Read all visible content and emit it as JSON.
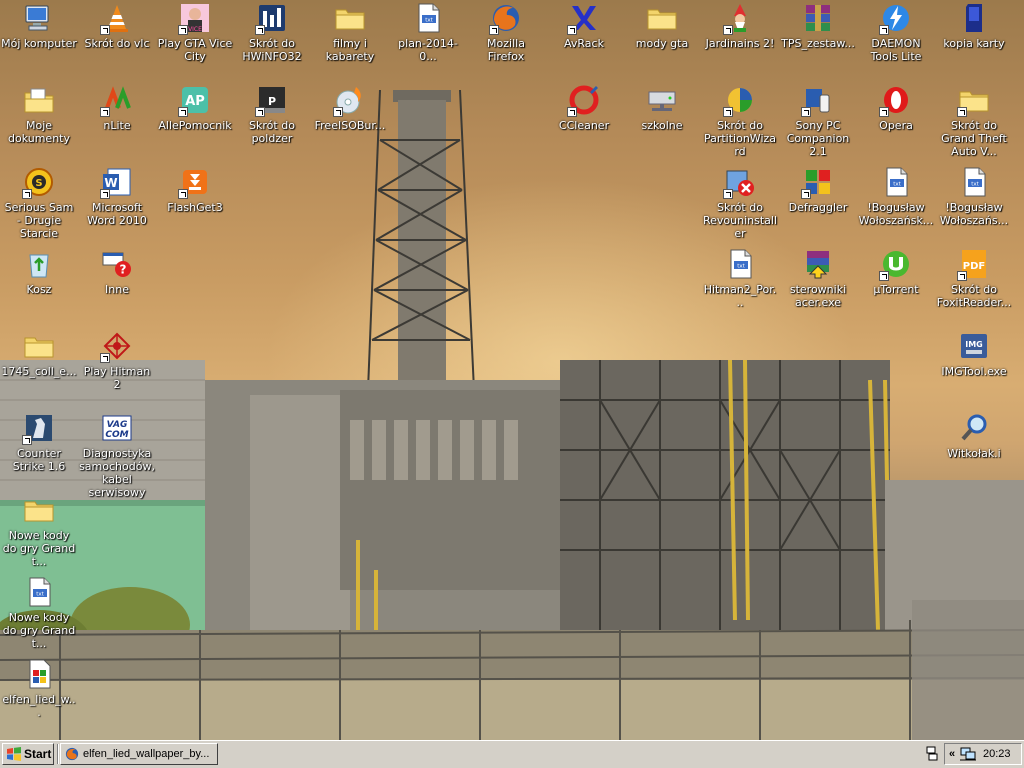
{
  "desktop": {
    "icons": [
      {
        "label": "Mój komputer",
        "icon": "computer-icon",
        "shortcut": false
      },
      {
        "label": "Skrót do vlc",
        "icon": "vlc-cone-icon",
        "shortcut": true
      },
      {
        "label": "Play GTA Vice City",
        "icon": "gta-vice-city-icon",
        "shortcut": true
      },
      {
        "label": "Skrót do HWiNFO32",
        "icon": "hwinfo-icon",
        "shortcut": true
      },
      {
        "label": "filmy i kabarety",
        "icon": "folder-icon",
        "shortcut": false
      },
      {
        "label": "plan-2014-0...",
        "icon": "document-icon",
        "shortcut": false
      },
      {
        "label": "Mozilla Firefox",
        "icon": "firefox-icon",
        "shortcut": true
      },
      {
        "label": "AvRack",
        "icon": "avrack-icon",
        "shortcut": true
      },
      {
        "label": "mody gta",
        "icon": "folder-icon",
        "shortcut": false
      },
      {
        "label": "Jardinains 2!",
        "icon": "jardinains-gnome-icon",
        "shortcut": true
      },
      {
        "label": "TPS_zestaw...",
        "icon": "winrar-icon",
        "shortcut": false
      },
      {
        "label": "DAEMON Tools Lite",
        "icon": "daemon-tools-icon",
        "shortcut": true
      },
      {
        "label": "kopia karty",
        "icon": "memory-card-icon",
        "shortcut": false
      },
      {
        "label": "Moje dokumenty",
        "icon": "my-documents-icon",
        "shortcut": false
      },
      {
        "label": "nLite",
        "icon": "nlite-icon",
        "shortcut": true
      },
      {
        "label": "AllePomocnik",
        "icon": "allepomocnik-icon",
        "shortcut": true
      },
      {
        "label": "Skrót do poldzer",
        "icon": "poldzer-icon",
        "shortcut": true
      },
      {
        "label": "FreeISOBur...",
        "icon": "cd-burner-icon",
        "shortcut": true
      },
      {
        "label": "CCleaner",
        "icon": "ccleaner-icon",
        "shortcut": true
      },
      {
        "label": "szkolne",
        "icon": "network-drive-icon",
        "shortcut": false
      },
      {
        "label": "Skrót do PartitionWizard",
        "icon": "partition-wizard-icon",
        "shortcut": true
      },
      {
        "label": "Sony PC Companion 2.1",
        "icon": "sony-pc-companion-icon",
        "shortcut": true
      },
      {
        "label": "Opera",
        "icon": "opera-icon",
        "shortcut": true
      },
      {
        "label": "Skrót do Grand Theft Auto V...",
        "icon": "folder-icon",
        "shortcut": true
      },
      {
        "label": "Serious Sam - Drugie Starcie",
        "icon": "serious-sam-icon",
        "shortcut": true
      },
      {
        "label": "Microsoft Word 2010",
        "icon": "word-icon",
        "shortcut": true
      },
      {
        "label": "FlashGet3",
        "icon": "flashget-icon",
        "shortcut": true
      },
      {
        "label": "Skrót do Revouninstaller",
        "icon": "revo-uninstaller-icon",
        "shortcut": true
      },
      {
        "label": "Defraggler",
        "icon": "defraggler-icon",
        "shortcut": true
      },
      {
        "label": "!Bogusław Wołoszańsk...",
        "icon": "document-icon",
        "shortcut": false
      },
      {
        "label": "!Bogusław Wołoszańs...",
        "icon": "document-icon",
        "shortcut": false
      },
      {
        "label": "Kosz",
        "icon": "recycle-bin-icon",
        "shortcut": false
      },
      {
        "label": "Inne",
        "icon": "inne-help-icon",
        "shortcut": false
      },
      {
        "label": "Hitman2_Por...",
        "icon": "document-icon",
        "shortcut": false
      },
      {
        "label": "sterowniki acer.exe",
        "icon": "winrar-sfx-icon",
        "shortcut": false
      },
      {
        "label": "µTorrent",
        "icon": "utorrent-icon",
        "shortcut": true
      },
      {
        "label": "Skrót do FoxitReader...",
        "icon": "foxit-reader-icon",
        "shortcut": true
      },
      {
        "label": "1745_coll_e...",
        "icon": "folder-icon",
        "shortcut": false
      },
      {
        "label": "Play Hitman 2",
        "icon": "hitman-icon",
        "shortcut": true
      },
      {
        "label": "IMGTool.exe",
        "icon": "imgtool-icon",
        "shortcut": false
      },
      {
        "label": "Counter Strike 1.6",
        "icon": "counter-strike-icon",
        "shortcut": true
      },
      {
        "label": "Diagnostyka samochodów, kabel serwisowy",
        "icon": "vag-com-icon",
        "shortcut": false
      },
      {
        "label": "Witkołak.i",
        "icon": "magnifier-icon",
        "shortcut": false
      },
      {
        "label": "Nowe kody do gry Grand t...",
        "icon": "folder-icon",
        "shortcut": false
      },
      {
        "label": "Nowe kody do gry Grand t...",
        "icon": "document-icon",
        "shortcut": false
      },
      {
        "label": "elfen_lied_w...",
        "icon": "image-file-icon",
        "shortcut": false
      }
    ]
  },
  "taskbar": {
    "start_label": "Start",
    "tasks": [
      {
        "label": "elfen_lied_wallpaper_by...",
        "icon": "firefox-icon"
      }
    ],
    "tray_chevron": "«",
    "clock": "20:23"
  }
}
